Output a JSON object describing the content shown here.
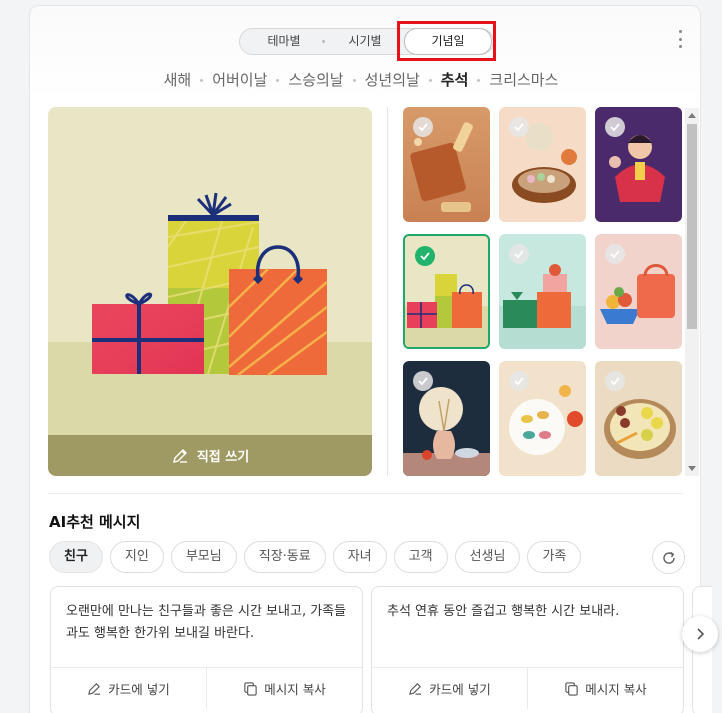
{
  "mode_tabs": [
    {
      "label": "테마별"
    },
    {
      "label": "시기별"
    },
    {
      "label": "기념일",
      "active": true
    }
  ],
  "categories": [
    {
      "label": "새해"
    },
    {
      "label": "어버이날"
    },
    {
      "label": "스승의날"
    },
    {
      "label": "성년의날"
    },
    {
      "label": "추석",
      "active": true
    },
    {
      "label": "크리스마스"
    }
  ],
  "preview": {
    "write_label": "직접 쓰기",
    "icon": "pencil-icon"
  },
  "thumbnails": [
    {
      "name": "rice-cakes-and-lantern",
      "selected": false
    },
    {
      "name": "teapot-and-songpyeon",
      "selected": false
    },
    {
      "name": "girl-in-hanbok",
      "selected": false
    },
    {
      "name": "gift-boxes",
      "selected": true
    },
    {
      "name": "stacked-gift-boxes-mint",
      "selected": false
    },
    {
      "name": "fruit-bowl-and-bag",
      "selected": false
    },
    {
      "name": "moon-and-vase",
      "selected": false
    },
    {
      "name": "songpyeon-plate",
      "selected": false
    },
    {
      "name": "jeon-platter",
      "selected": false
    }
  ],
  "ai": {
    "title": "AI추천 메시지",
    "chips": [
      {
        "label": "친구",
        "active": true
      },
      {
        "label": "지인"
      },
      {
        "label": "부모님"
      },
      {
        "label": "직장·동료"
      },
      {
        "label": "자녀"
      },
      {
        "label": "고객"
      },
      {
        "label": "선생님"
      },
      {
        "label": "가족"
      }
    ],
    "refresh_icon": "refresh-icon"
  },
  "messages": [
    {
      "text": "오랜만에 만나는 친구들과 좋은 시간 보내고, 가족들과도 행복한 한가위 보내길 바란다.",
      "insert_label": "카드에 넣기",
      "copy_label": "메시지 복사"
    },
    {
      "text": "추석 연휴 동안 즐겁고 행복한 시간 보내라.",
      "insert_label": "카드에 넣기",
      "copy_label": "메시지 복사"
    }
  ],
  "colors": {
    "highlight": "#e5121b",
    "selected": "#21b36b",
    "write_bar": "#9f9a63"
  }
}
